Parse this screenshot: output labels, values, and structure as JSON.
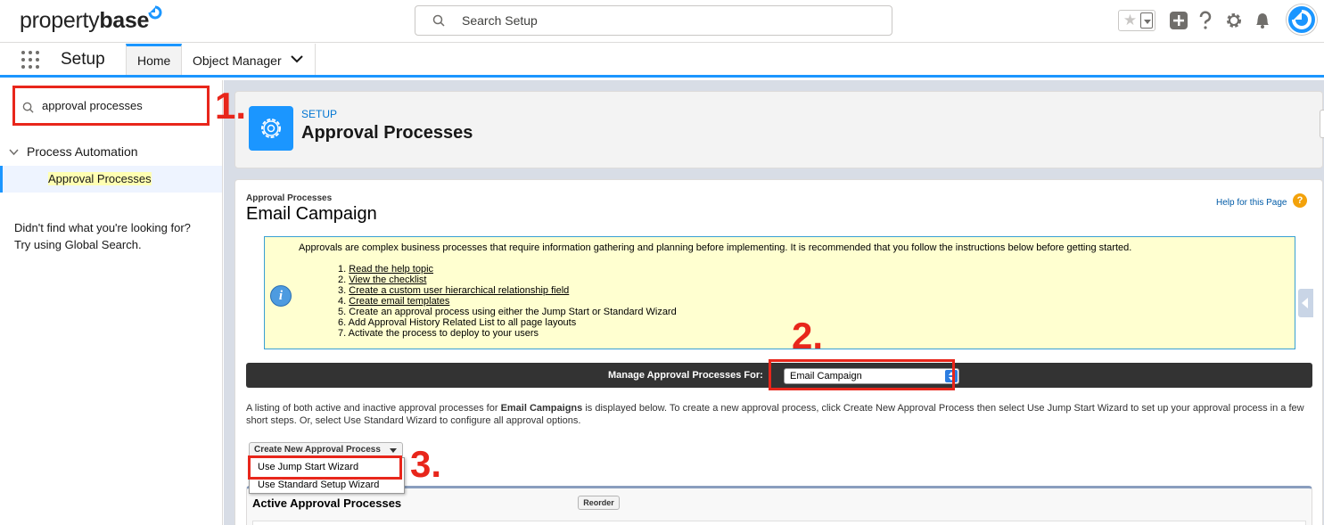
{
  "header": {
    "logo_text_light": "property",
    "logo_text_bold": "base",
    "search_placeholder": "Search Setup",
    "brand_color": "#1b96ff"
  },
  "nav": {
    "app_name": "Setup",
    "tabs": [
      {
        "label": "Home",
        "active": true
      },
      {
        "label": "Object Manager",
        "active": false
      }
    ]
  },
  "sidebar": {
    "quick_find_value": "approval processes",
    "category": "Process Automation",
    "item": "Approval Processes",
    "not_found_line1": "Didn't find what you're looking for?",
    "not_found_line2": "Try using Global Search."
  },
  "page_header": {
    "kicker": "SETUP",
    "title": "Approval Processes"
  },
  "content": {
    "kicker": "Approval Processes",
    "title": "Email Campaign",
    "help_link": "Help for this Page",
    "info_intro": "Approvals are complex business processes that require information gathering and planning before implementing. It is recommended that you follow the instructions below before getting started.",
    "steps": [
      {
        "num": "1.",
        "text": "Read the help topic",
        "link": true
      },
      {
        "num": "2.",
        "text": "View the checklist",
        "link": true
      },
      {
        "num": "3.",
        "text": "Create a custom user hierarchical relationship field",
        "link": true
      },
      {
        "num": "4.",
        "text": "Create email templates",
        "link": true
      },
      {
        "num": "5.",
        "text": "Create an approval process using either the Jump Start or Standard Wizard",
        "link": false
      },
      {
        "num": "6.",
        "text": "Add Approval History Related List to all page layouts",
        "link": false
      },
      {
        "num": "7.",
        "text": "Activate the process to deploy to your users",
        "link": false
      }
    ],
    "manage_label": "Manage Approval Processes For:",
    "manage_value": "Email Campaign",
    "desc_before": "A listing of both active and inactive approval processes for ",
    "desc_bold": "Email Campaigns",
    "desc_after": " is displayed below. To create a new approval process, click Create New Approval Process then select Use Jump Start Wizard to set up your approval process in a few short steps. Or, select Use Standard Wizard to configure all approval options.",
    "create_button": "Create New Approval Process",
    "menu_items": [
      "Use Jump Start Wizard",
      "Use Standard Setup Wizard"
    ],
    "active_title": "Active Approval Processes",
    "reorder_button": "Reorder"
  },
  "callouts": {
    "one": "1.",
    "two": "2.",
    "three": "3.",
    "color": "#e8261b"
  }
}
